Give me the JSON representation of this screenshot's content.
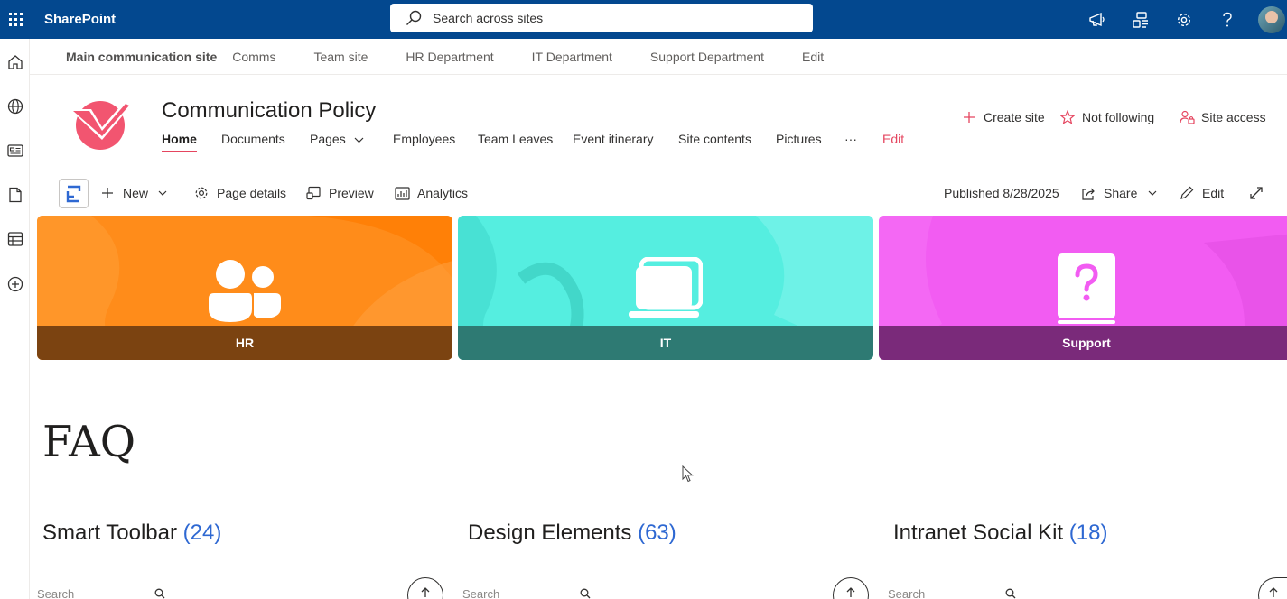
{
  "suitebar": {
    "app_name": "SharePoint",
    "search_placeholder": "Search across sites",
    "icons": [
      "megaphone-icon",
      "app-connect-icon",
      "gear-icon",
      "help-icon"
    ]
  },
  "hubnav": {
    "title": "Main communication site",
    "items": [
      "Comms",
      "Team site",
      "HR Department",
      "IT Department",
      "Support Department",
      "Edit"
    ]
  },
  "site": {
    "title": "Communication Policy",
    "nav": [
      "Home",
      "Documents",
      "Pages",
      "Employees",
      "Team Leaves",
      "Event itinerary",
      "Site contents",
      "Pictures",
      "···",
      "Edit"
    ],
    "actions": [
      "Create site",
      "Not following",
      "Site access"
    ],
    "accent_color": "#e5455f"
  },
  "commandbar": {
    "new_label": "New",
    "page_details_label": "Page details",
    "preview_label": "Preview",
    "analytics_label": "Analytics",
    "published_label": "Published 8/28/2025",
    "share_label": "Share",
    "edit_label": "Edit"
  },
  "tiles": [
    {
      "label": "HR",
      "color": "#ff8c1a",
      "band": "#7b4311"
    },
    {
      "label": "IT",
      "color": "#55eee0",
      "band": "#2e7a73"
    },
    {
      "label": "Support",
      "color": "#f25cf2",
      "band": "#7a2a7a"
    }
  ],
  "faq": {
    "title": "FAQ",
    "columns": [
      {
        "name": "Smart Toolbar",
        "count": "(24)",
        "search_placeholder": "Search"
      },
      {
        "name": "Design Elements",
        "count": "(63)",
        "search_placeholder": "Search"
      },
      {
        "name": "Intranet Social Kit",
        "count": "(18)",
        "search_placeholder": "Search"
      }
    ]
  }
}
